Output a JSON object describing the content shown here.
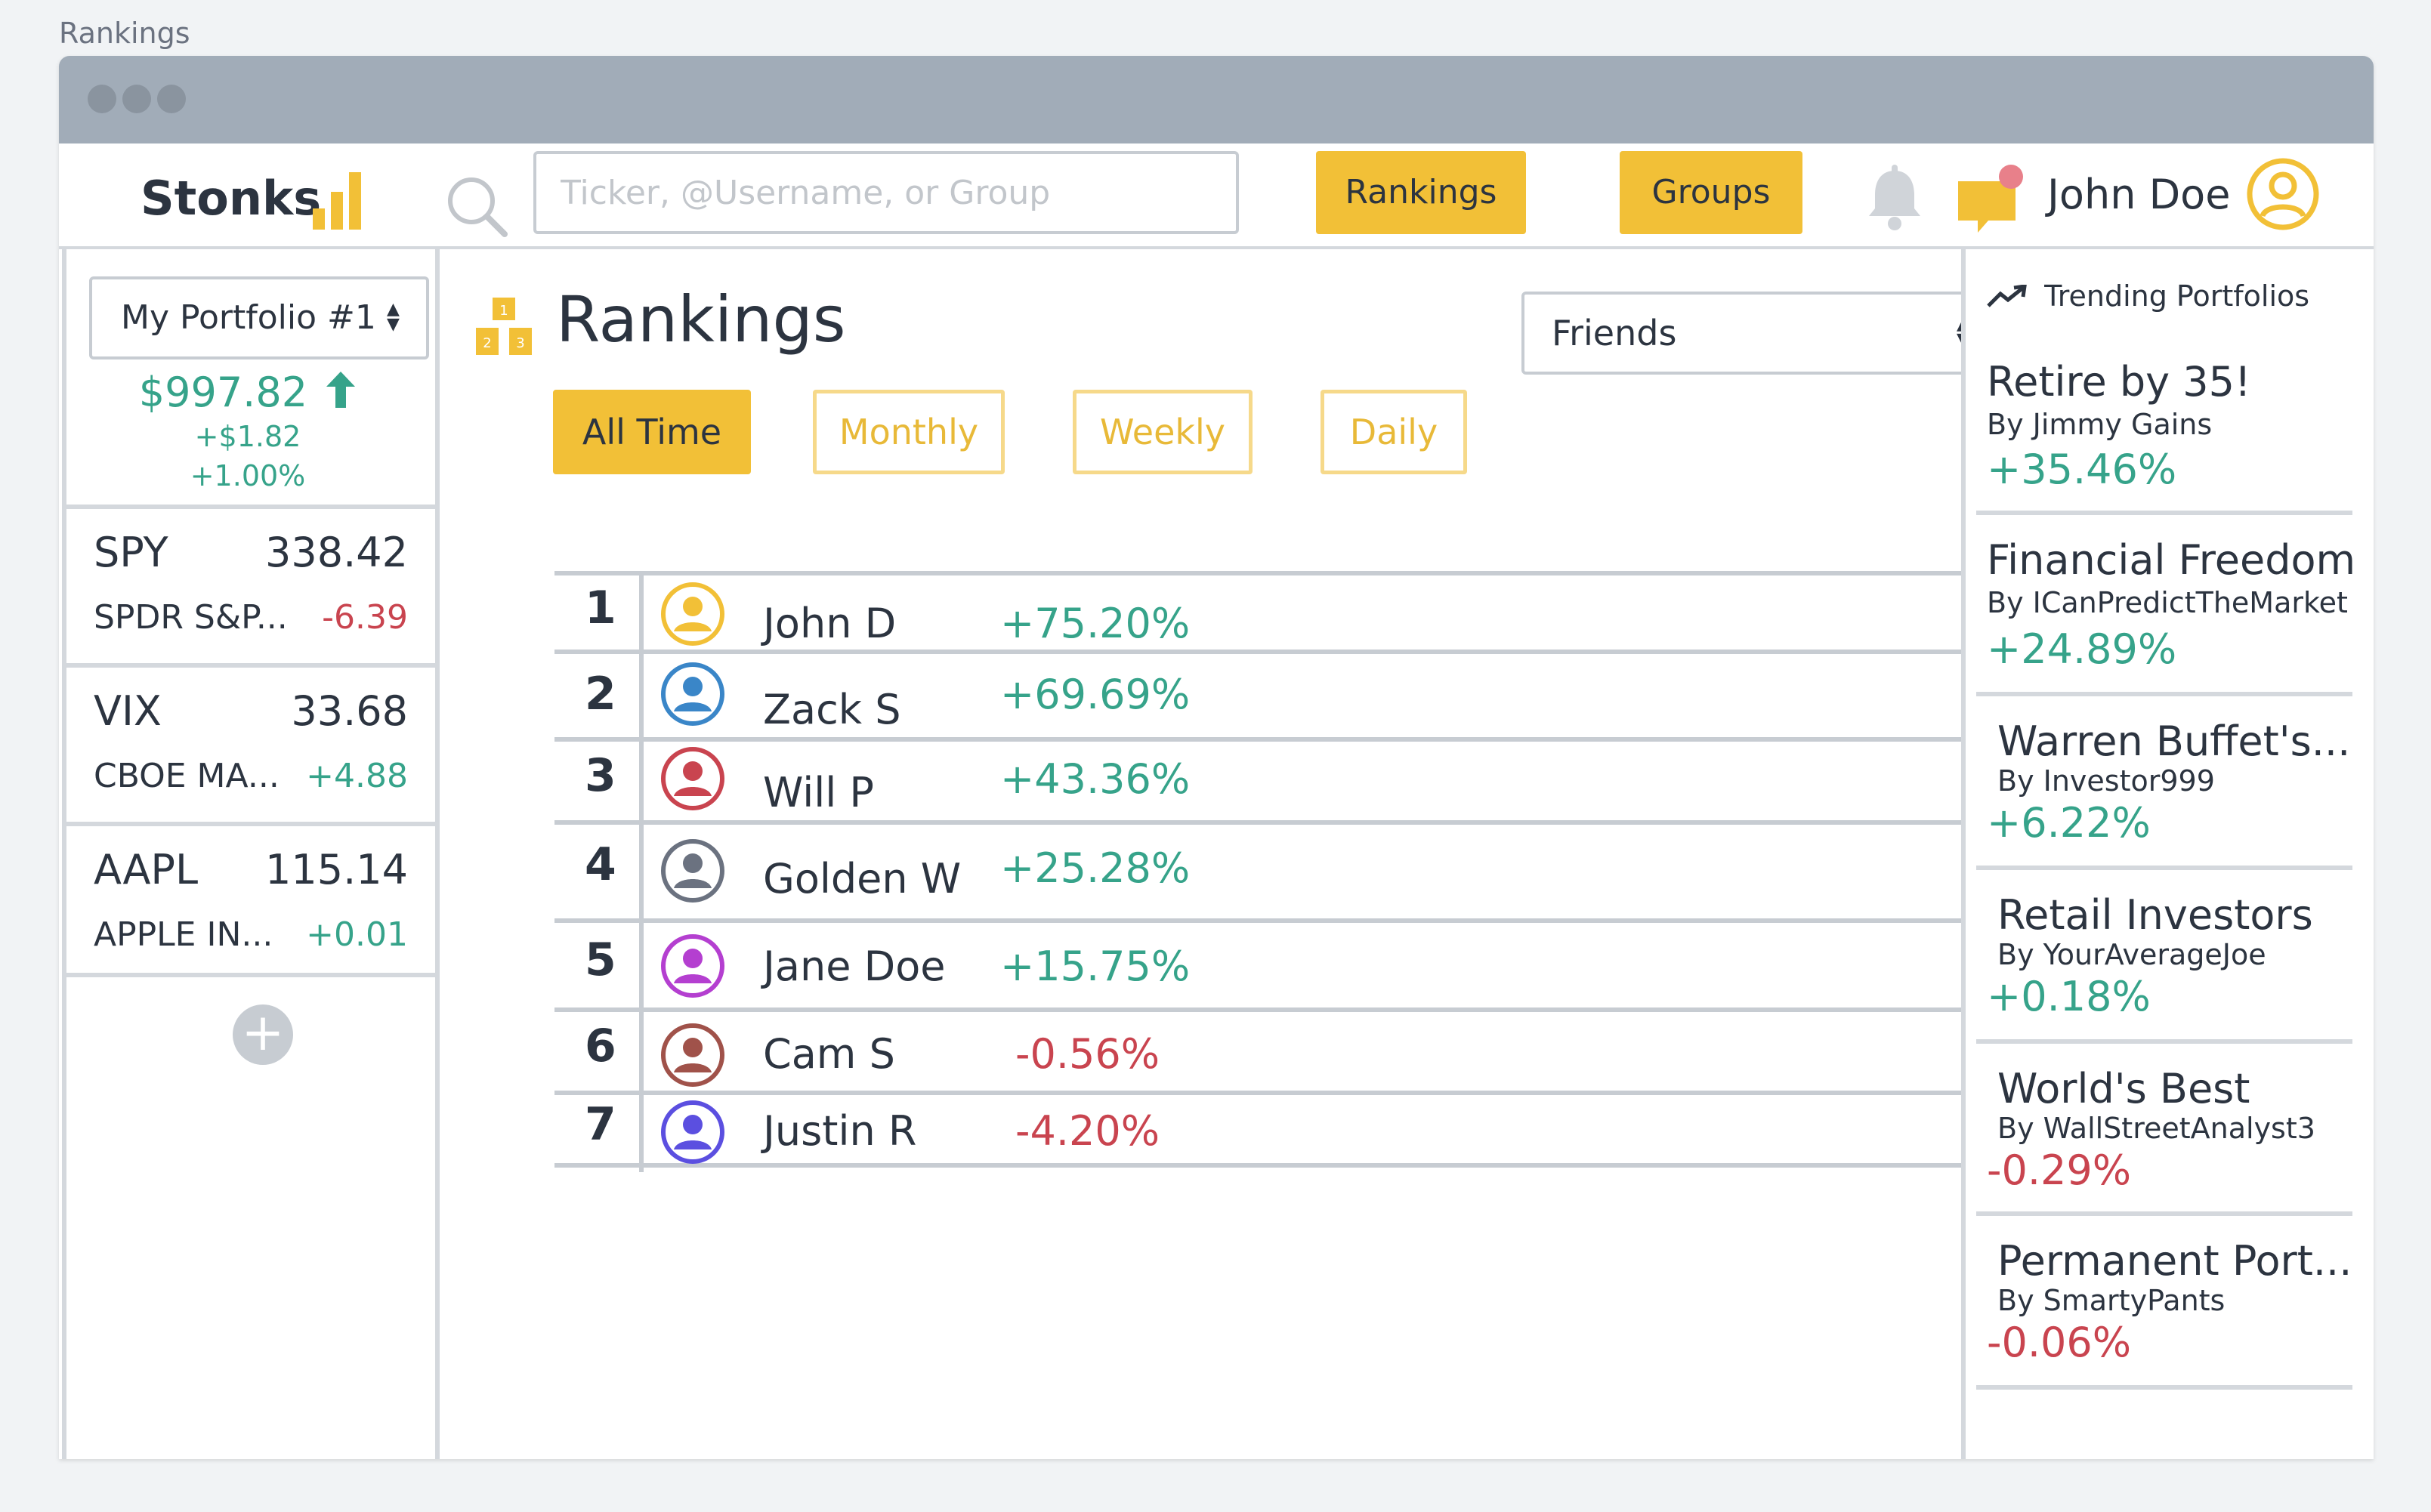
{
  "page_label": "Rankings",
  "colors": {
    "accent": "#f2c037",
    "positive": "#36a38a",
    "negative": "#c9444f",
    "border": "#d4d8dd"
  },
  "header": {
    "logo": "Stonks",
    "search_placeholder": "Ticker, @Username, or Group",
    "rankings_button": "Rankings",
    "groups_button": "Groups",
    "user_name": "John Doe",
    "icons": [
      "search-icon",
      "bell-icon",
      "chat-icon",
      "user-avatar-icon"
    ]
  },
  "portfolio": {
    "selected": "My Portfolio #1",
    "balance": "$997.82",
    "change_abs": "+$1.82",
    "change_pct": "+1.00%",
    "tickers": [
      {
        "symbol": "SPY",
        "price": "338.42",
        "name": "SPDR S&P...",
        "change": "-6.39",
        "direction": "neg"
      },
      {
        "symbol": "VIX",
        "price": "33.68",
        "name": "CBOE MA...",
        "change": "+4.88",
        "direction": "pos"
      },
      {
        "symbol": "AAPL",
        "price": "115.14",
        "name": "APPLE IN...",
        "change": "+0.01",
        "direction": "pos"
      }
    ]
  },
  "main": {
    "title": "Rankings",
    "scope_select": "Friends",
    "filters": [
      "All Time",
      "Monthly",
      "Weekly",
      "Daily"
    ],
    "active_filter": "All Time",
    "rows": [
      {
        "rank": "1",
        "name": "John D",
        "pct": "+75.20%",
        "direction": "pos",
        "avatar_color": "#f2c037"
      },
      {
        "rank": "2",
        "name": "Zack S",
        "pct": "+69.69%",
        "direction": "pos",
        "avatar_color": "#3a86c8"
      },
      {
        "rank": "3",
        "name": "Will P",
        "pct": "+43.36%",
        "direction": "pos",
        "avatar_color": "#c9444f"
      },
      {
        "rank": "4",
        "name": "Golden W",
        "pct": "+25.28%",
        "direction": "pos",
        "avatar_color": "#6b7280"
      },
      {
        "rank": "5",
        "name": "Jane Doe",
        "pct": "+15.75%",
        "direction": "pos",
        "avatar_color": "#b43fd0"
      },
      {
        "rank": "6",
        "name": "Cam S",
        "pct": "-0.56%",
        "direction": "neg",
        "avatar_color": "#a0524a"
      },
      {
        "rank": "7",
        "name": "Justin R",
        "pct": "-4.20%",
        "direction": "neg",
        "avatar_color": "#5b4fe0"
      }
    ]
  },
  "trending": {
    "header": "Trending Portfolios",
    "items": [
      {
        "name": "Retire by 35!",
        "by": "By Jimmy Gains",
        "pct": "+35.46%",
        "direction": "pos"
      },
      {
        "name": "Financial Freedom",
        "by": "By ICanPredictTheMarket",
        "pct": "+24.89%",
        "direction": "pos"
      },
      {
        "name": "Warren Buffet's...",
        "by": "By Investor999",
        "pct": "+6.22%",
        "direction": "pos"
      },
      {
        "name": "Retail Investors",
        "by": "By YourAverageJoe",
        "pct": "+0.18%",
        "direction": "pos"
      },
      {
        "name": "World's Best",
        "by": "By WallStreetAnalyst3",
        "pct": "-0.29%",
        "direction": "neg"
      },
      {
        "name": "Permanent Port...",
        "by": "By SmartyPants",
        "pct": "-0.06%",
        "direction": "neg"
      }
    ]
  }
}
